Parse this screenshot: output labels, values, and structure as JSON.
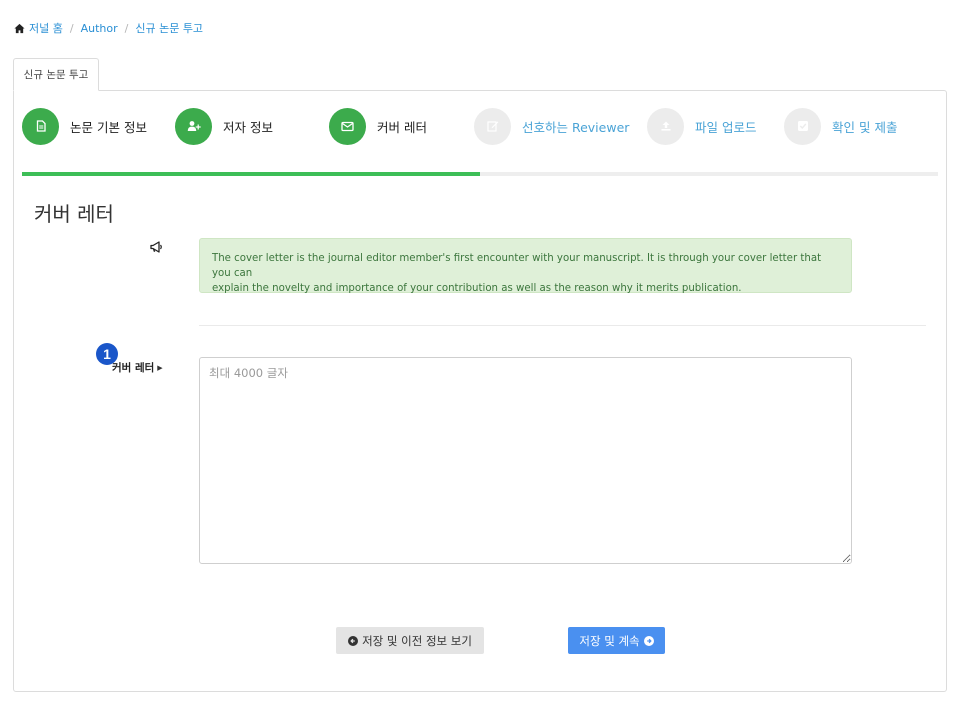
{
  "breadcrumb": {
    "items": [
      "저널 홈",
      "Author",
      "신규 논문 투고"
    ],
    "separator": "/"
  },
  "tab": {
    "label": "신규 논문 투고"
  },
  "steps": [
    {
      "label": "논문 기본 정보",
      "icon": "document-icon",
      "status": "done"
    },
    {
      "label": "저자 정보",
      "icon": "add-user-icon",
      "status": "done"
    },
    {
      "label": "커버 레터",
      "icon": "envelope-icon",
      "status": "done"
    },
    {
      "label": "선호하는 Reviewer",
      "icon": "edit-icon",
      "status": "todo"
    },
    {
      "label": "파일 업로드",
      "icon": "upload-icon",
      "status": "todo"
    },
    {
      "label": "확인 및 제출",
      "icon": "check-icon",
      "status": "todo"
    }
  ],
  "progress": {
    "fraction": 0.5
  },
  "section": {
    "title": "커버 레터"
  },
  "info": {
    "line1": "The cover letter is the journal editor member's first encounter with your manuscript. It is through your cover letter that you can",
    "line2": "explain the novelty and importance of your contribution as well as the reason why it merits publication."
  },
  "field": {
    "badge": "1",
    "label": "커버 레터",
    "placeholder": "최대 4000 글자",
    "value": ""
  },
  "buttons": {
    "prev_label": "저장 및 이전 정보 보기",
    "next_label": "저장 및 계속"
  },
  "colors": {
    "done_step": "#3cab4c",
    "todo_step": "#ececec",
    "progress_fill": "#3dbe57",
    "link": "#2a8fd4",
    "info_bg": "#dff0d8",
    "info_text": "#3c763d",
    "primary_button": "#4a90f0",
    "badge": "#1a56c9"
  }
}
